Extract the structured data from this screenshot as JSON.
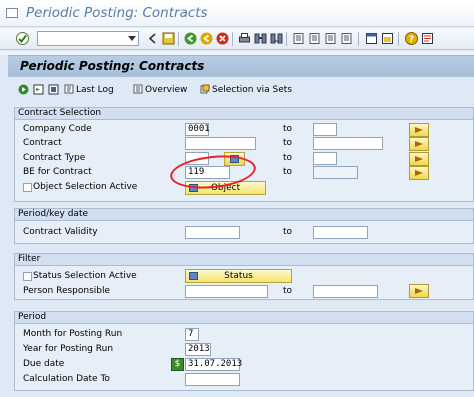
{
  "window": {
    "title": "Periodic Posting: Contracts"
  },
  "toolbar": {
    "icons": [
      "enter-icon",
      "save-icon",
      "back-icon",
      "exit-icon",
      "cancel-icon",
      "print-icon",
      "find-icon",
      "find-next-icon",
      "first-page-icon",
      "previous-page-icon",
      "next-page-icon",
      "last-page-icon",
      "create-session-icon",
      "shortcut-icon",
      "help-icon",
      "layout-icon"
    ]
  },
  "app": {
    "title": "Periodic Posting: Contracts",
    "buttons": {
      "last_log": "Last Log",
      "overview": "Overview",
      "selection_via_sets": "Selection via Sets"
    }
  },
  "contract_selection": {
    "header": "Contract Selection",
    "to_label": "to",
    "company_code": {
      "label": "Company Code",
      "value": "0001"
    },
    "contract": {
      "label": "Contract"
    },
    "contract_type": {
      "label": "Contract Type"
    },
    "be_for_contract": {
      "label": "BE for Contract",
      "value": "119"
    },
    "object_selection": {
      "label": "Object Selection Active",
      "button": "Object"
    }
  },
  "period_key_date": {
    "header": "Period/key date",
    "contract_validity": {
      "label": "Contract Validity",
      "to_label": "to"
    }
  },
  "filter": {
    "header": "Filter",
    "status_selection": {
      "label": "Status Selection Active",
      "button": "Status"
    },
    "person_responsible": {
      "label": "Person Responsible",
      "to_label": "to"
    }
  },
  "period": {
    "header": "Period",
    "month_for_posting_run": {
      "label": "Month for Posting Run",
      "value": "7"
    },
    "year_for_posting_run": {
      "label": "Year for Posting Run",
      "value": "2013"
    },
    "due_date": {
      "label": "Due date",
      "value": "31.07.2013"
    },
    "calculation_date_to": {
      "label": "Calculation Date To"
    }
  },
  "colors": {
    "annotation_circle": "#e52222",
    "header_blue": "#5b7da6"
  }
}
